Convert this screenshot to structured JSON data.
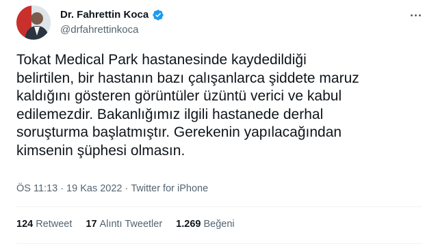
{
  "author": {
    "name": "Dr. Fahrettin Koca",
    "handle": "@drfahrettinkoca",
    "verified": true
  },
  "tweet": {
    "text": "Tokat Medical Park hastanesinde kaydedildiği\nbelirtilen, bir hastanın bazı çalışanlarca şiddete maruz\nkaldığını gösteren görüntüler üzüntü verici ve kabul\nedilemezdir. Bakanlığımız ilgili hastanede derhal\nsoruşturma başlatmıştır. Gerekenin yapılacağından\nkimsenin şüphesi olmasın.",
    "time": "ÖS 11:13",
    "separator": "·",
    "date": "19 Kas 2022",
    "source": "Twitter for iPhone"
  },
  "stats": {
    "retweets_count": "124",
    "retweets_label": "Retweet",
    "quotes_count": "17",
    "quotes_label": "Alıntı Tweetler",
    "likes_count": "1.269",
    "likes_label": "Beğeni"
  },
  "colors": {
    "verified_badge": "#1d9bf0",
    "secondary_text": "#536471",
    "primary_text": "#0f1419"
  }
}
